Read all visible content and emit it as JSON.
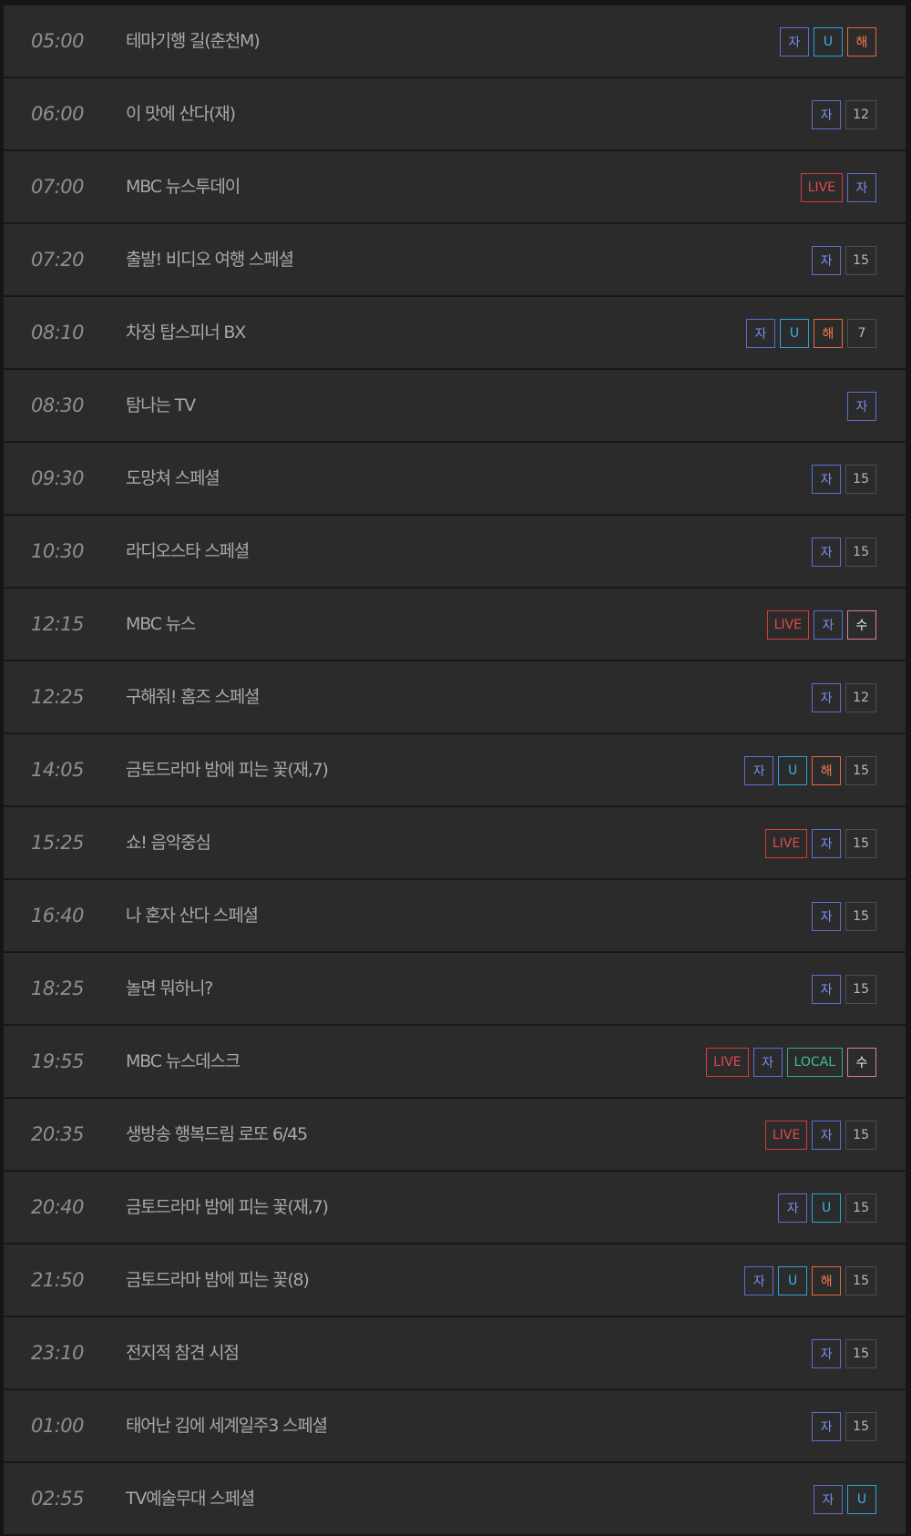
{
  "rows": [
    {
      "time": "05:00",
      "title": "테마기행 길(춘천M)",
      "badges": [
        {
          "label": "자",
          "type": "ja"
        },
        {
          "label": "U",
          "type": "u"
        },
        {
          "label": "해",
          "type": "hae"
        }
      ]
    },
    {
      "time": "06:00",
      "title": "이 맛에 산다(재)",
      "badges": [
        {
          "label": "자",
          "type": "ja"
        },
        {
          "label": "12",
          "type": "age"
        }
      ]
    },
    {
      "time": "07:00",
      "title": "MBC 뉴스투데이",
      "badges": [
        {
          "label": "LIVE",
          "type": "live"
        },
        {
          "label": "자",
          "type": "ja"
        }
      ]
    },
    {
      "time": "07:20",
      "title": "출발! 비디오 여행 스페셜",
      "badges": [
        {
          "label": "자",
          "type": "ja"
        },
        {
          "label": "15",
          "type": "age"
        }
      ]
    },
    {
      "time": "08:10",
      "title": "차징 탑스피너 BX",
      "badges": [
        {
          "label": "자",
          "type": "ja"
        },
        {
          "label": "U",
          "type": "u"
        },
        {
          "label": "해",
          "type": "hae"
        },
        {
          "label": "7",
          "type": "age"
        }
      ]
    },
    {
      "time": "08:30",
      "title": "탐나는 TV",
      "badges": [
        {
          "label": "자",
          "type": "ja"
        }
      ]
    },
    {
      "time": "09:30",
      "title": "도망쳐 스페셜",
      "badges": [
        {
          "label": "자",
          "type": "ja"
        },
        {
          "label": "15",
          "type": "age"
        }
      ]
    },
    {
      "time": "10:30",
      "title": "라디오스타 스페셜",
      "badges": [
        {
          "label": "자",
          "type": "ja"
        },
        {
          "label": "15",
          "type": "age"
        }
      ]
    },
    {
      "time": "12:15",
      "title": "MBC 뉴스",
      "badges": [
        {
          "label": "LIVE",
          "type": "live"
        },
        {
          "label": "자",
          "type": "ja"
        },
        {
          "label": "수",
          "type": "su"
        }
      ]
    },
    {
      "time": "12:25",
      "title": "구해줘! 홈즈 스페셜",
      "badges": [
        {
          "label": "자",
          "type": "ja"
        },
        {
          "label": "12",
          "type": "age"
        }
      ]
    },
    {
      "time": "14:05",
      "title": "금토드라마 밤에 피는 꽃(재,7)",
      "badges": [
        {
          "label": "자",
          "type": "ja"
        },
        {
          "label": "U",
          "type": "u"
        },
        {
          "label": "해",
          "type": "hae"
        },
        {
          "label": "15",
          "type": "age"
        }
      ]
    },
    {
      "time": "15:25",
      "title": "쇼! 음악중심",
      "badges": [
        {
          "label": "LIVE",
          "type": "live"
        },
        {
          "label": "자",
          "type": "ja"
        },
        {
          "label": "15",
          "type": "age"
        }
      ]
    },
    {
      "time": "16:40",
      "title": "나 혼자 산다 스페셜",
      "badges": [
        {
          "label": "자",
          "type": "ja"
        },
        {
          "label": "15",
          "type": "age"
        }
      ]
    },
    {
      "time": "18:25",
      "title": "놀면 뭐하니?",
      "badges": [
        {
          "label": "자",
          "type": "ja"
        },
        {
          "label": "15",
          "type": "age"
        }
      ]
    },
    {
      "time": "19:55",
      "title": "MBC 뉴스데스크",
      "badges": [
        {
          "label": "LIVE",
          "type": "live"
        },
        {
          "label": "자",
          "type": "ja"
        },
        {
          "label": "LOCAL",
          "type": "local"
        },
        {
          "label": "수",
          "type": "su"
        }
      ]
    },
    {
      "time": "20:35",
      "title": "생방송 행복드림 로또 6/45",
      "badges": [
        {
          "label": "LIVE",
          "type": "live"
        },
        {
          "label": "자",
          "type": "ja"
        },
        {
          "label": "15",
          "type": "age"
        }
      ]
    },
    {
      "time": "20:40",
      "title": "금토드라마 밤에 피는 꽃(재,7)",
      "badges": [
        {
          "label": "자",
          "type": "ja"
        },
        {
          "label": "U",
          "type": "u"
        },
        {
          "label": "15",
          "type": "age"
        }
      ]
    },
    {
      "time": "21:50",
      "title": "금토드라마 밤에 피는 꽃(8)",
      "badges": [
        {
          "label": "자",
          "type": "ja"
        },
        {
          "label": "U",
          "type": "u"
        },
        {
          "label": "해",
          "type": "hae"
        },
        {
          "label": "15",
          "type": "age"
        }
      ]
    },
    {
      "time": "23:10",
      "title": "전지적 참견 시점",
      "badges": [
        {
          "label": "자",
          "type": "ja"
        },
        {
          "label": "15",
          "type": "age"
        }
      ]
    },
    {
      "time": "01:00",
      "title": "태어난 김에 세계일주3 스페셜",
      "badges": [
        {
          "label": "자",
          "type": "ja"
        },
        {
          "label": "15",
          "type": "age"
        }
      ]
    },
    {
      "time": "02:55",
      "title": "TV예술무대 스페셜",
      "badges": [
        {
          "label": "자",
          "type": "ja"
        },
        {
          "label": "U",
          "type": "u"
        }
      ]
    }
  ]
}
